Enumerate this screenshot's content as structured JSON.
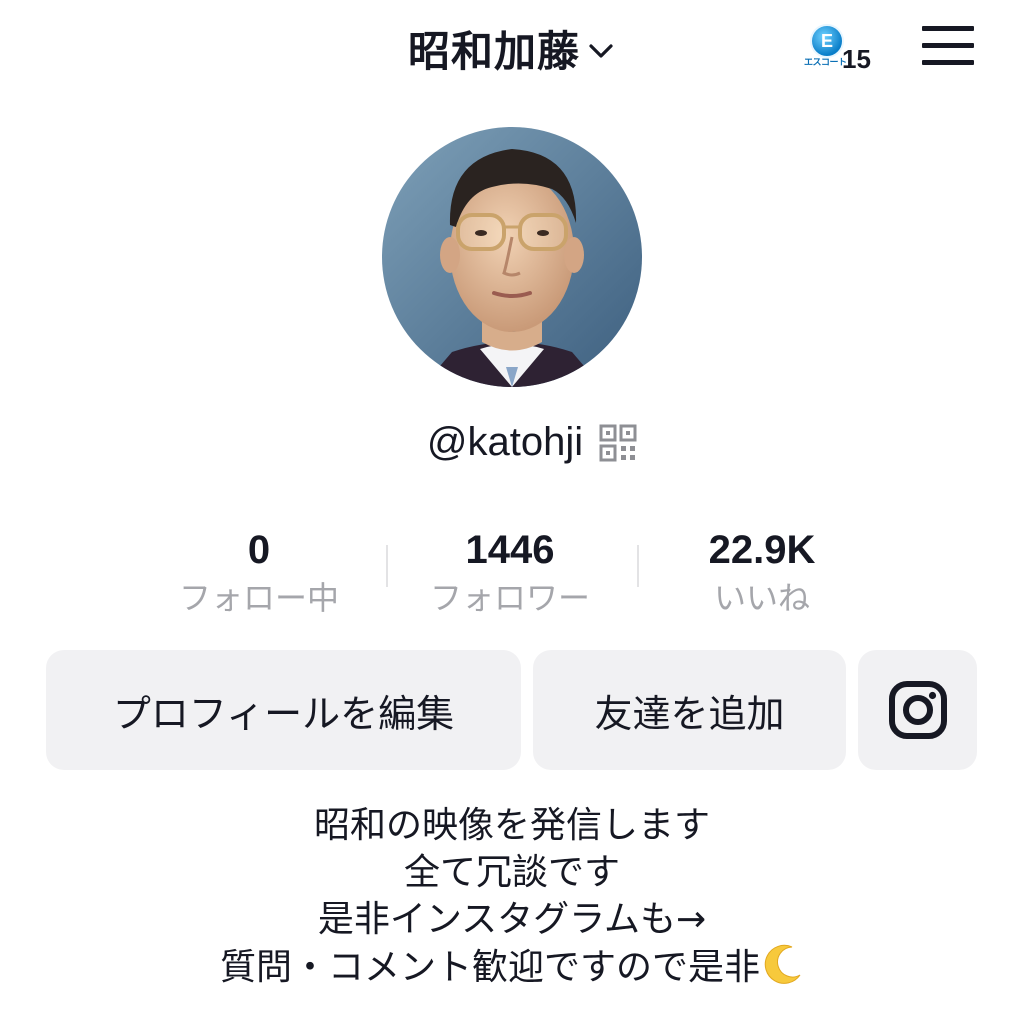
{
  "header": {
    "account_name": "昭和加藤",
    "coin_badge": {
      "letter": "E",
      "sub_label": "エスコート",
      "count": "15"
    },
    "icons": {
      "switcher": "chevron-down-icon",
      "menu": "hamburger-menu-icon"
    }
  },
  "profile": {
    "username": "@katohji",
    "qr_icon": "qr-code-icon"
  },
  "stats": [
    {
      "value": "0",
      "label": "フォロー中"
    },
    {
      "value": "1446",
      "label": "フォロワー"
    },
    {
      "value": "22.9K",
      "label": "いいね"
    }
  ],
  "actions": {
    "edit_profile": "プロフィールを編集",
    "add_friend": "友達を追加",
    "instagram_icon": "instagram-icon"
  },
  "bio": {
    "lines": [
      "昭和の映像を発信します",
      "全て冗談です",
      "是非インスタグラムも→",
      "質問・コメント歓迎ですので是非"
    ],
    "trailing_emoji": "crescent-moon-icon"
  },
  "colors": {
    "text_primary": "#161823",
    "text_secondary": "#a5a6ab",
    "button_bg": "#f1f1f3",
    "coin_blue": "#0a7ec9"
  }
}
